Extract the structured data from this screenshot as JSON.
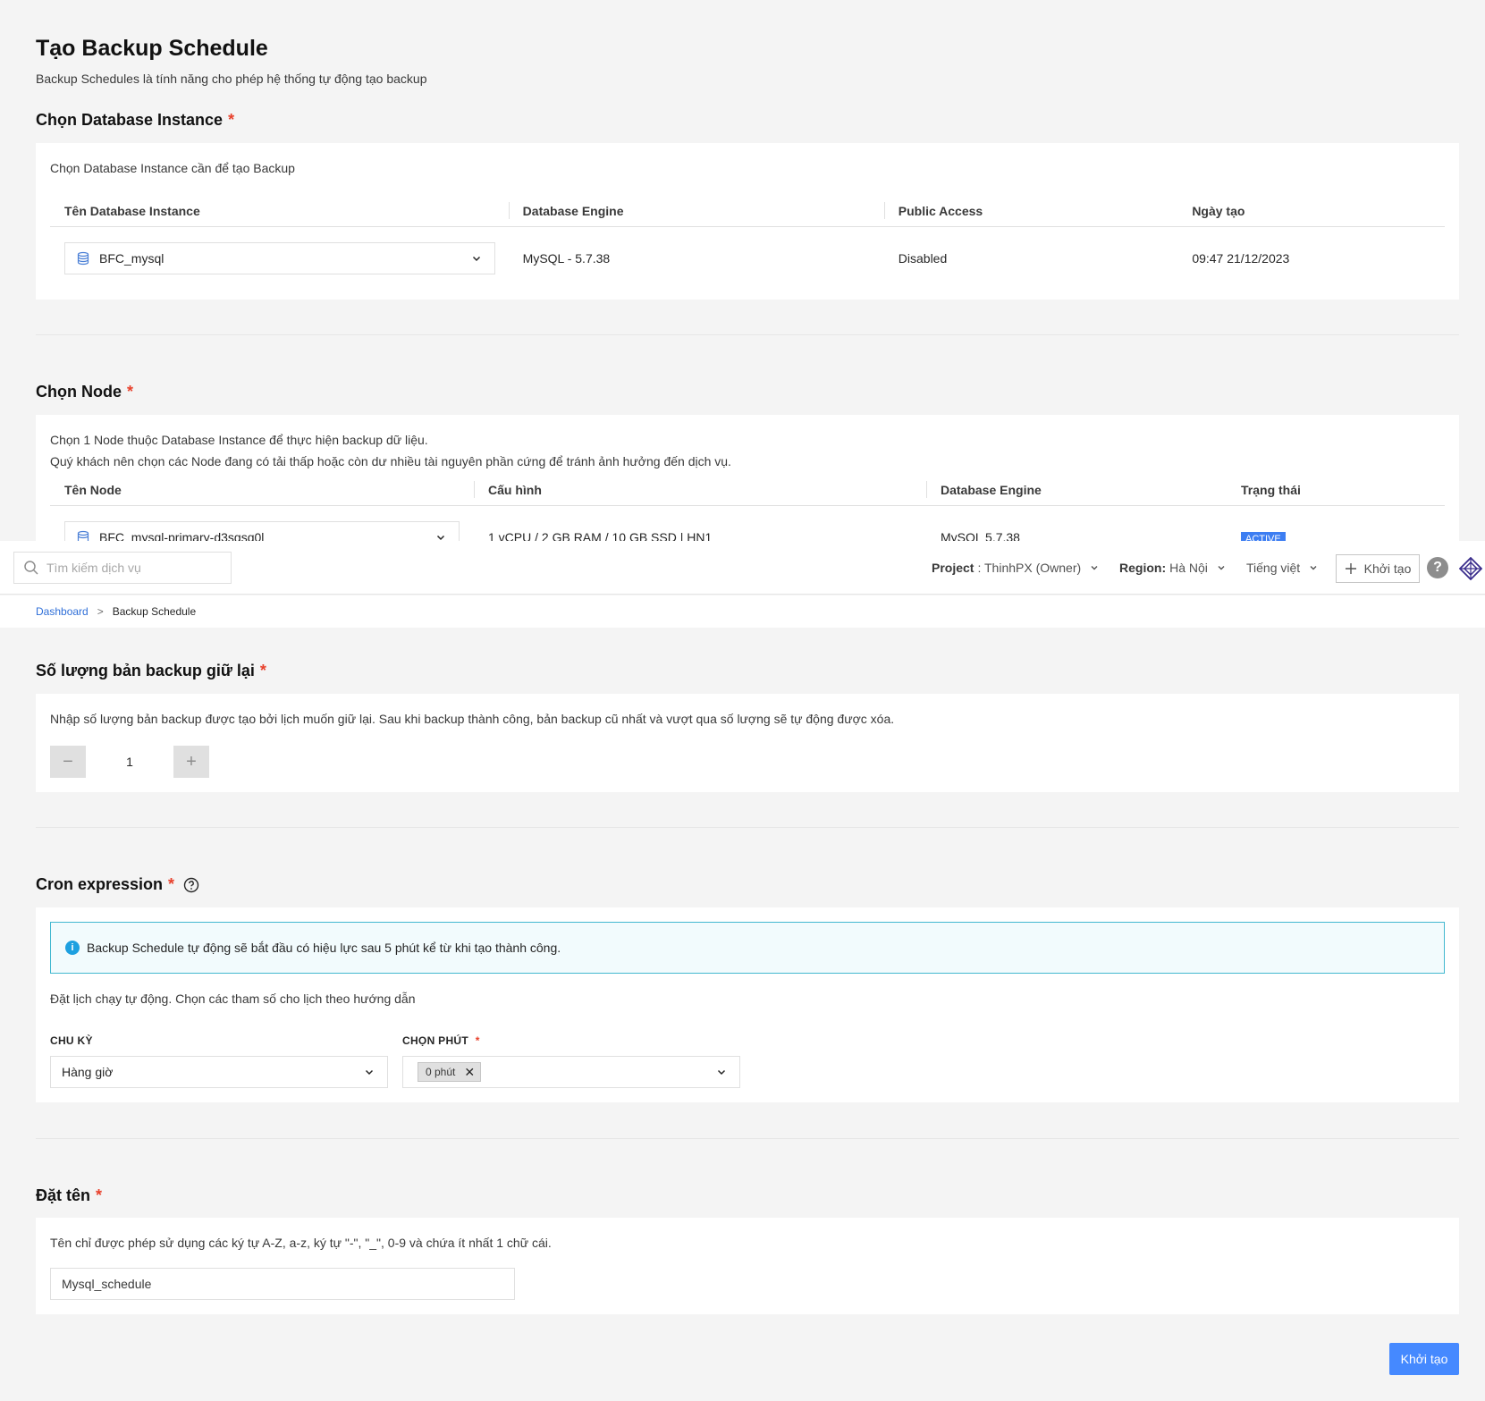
{
  "page": {
    "title": "Tạo Backup Schedule",
    "subtitle": "Backup Schedules là tính năng cho phép hệ thống tự động tạo backup"
  },
  "instance_section": {
    "title": "Chọn Database Instance",
    "required": "*",
    "description": "Chọn Database Instance cần để tạo Backup",
    "columns": [
      "Tên Database Instance",
      "Database Engine",
      "Public Access",
      "Ngày tạo"
    ],
    "row": {
      "name": "BFC_mysql",
      "engine": "MySQL - 5.7.38",
      "public_access": "Disabled",
      "created": "09:47 21/12/2023"
    }
  },
  "node_section": {
    "title": "Chọn Node",
    "required": "*",
    "description_line1": "Chọn 1 Node thuộc Database Instance để thực hiện backup dữ liệu.",
    "description_line2": "Quý khách nên chọn các Node đang có tải thấp hoặc còn dư nhiều tài nguyên phần cứng để tránh ảnh hưởng đến dịch vụ.",
    "columns": [
      "Tên Node",
      "Cấu hình",
      "Database Engine",
      "Trạng thái"
    ],
    "row": {
      "name": "BFC_mysql-primary-d3sgsq0l",
      "config": "1 vCPU / 2 GB RAM / 10 GB SSD | HN1",
      "engine": "MySQL 5.7.38",
      "status": "ACTIVE"
    }
  },
  "topbar": {
    "search_placeholder": "Tìm kiếm dịch vụ",
    "project_label": "Project",
    "project_value": ": ThinhPX (Owner)",
    "region_label": "Region:",
    "region_value": "Hà Nội",
    "language": "Tiếng việt",
    "create_label": "Khởi tạo",
    "help": "?"
  },
  "breadcrumb": {
    "home": "Dashboard",
    "separator": ">",
    "current": "Backup Schedule"
  },
  "retention_section": {
    "title": "Số lượng bản backup giữ lại",
    "required": "*",
    "description": "Nhập số lượng bản backup được tạo bởi lịch muốn giữ lại. Sau khi backup thành công, bản backup cũ nhất và vượt qua số lượng sẽ tự động được xóa.",
    "value": "1",
    "minus": "−",
    "plus": "+"
  },
  "cron_section": {
    "title": "Cron expression",
    "required": "*",
    "info_text": "Backup Schedule tự động sẽ bắt đầu có hiệu lực sau 5 phút kể từ khi tạo thành công.",
    "description": "Đặt lịch chạy tự động. Chọn các tham số cho lịch theo hướng dẫn",
    "cycle_label": "CHU KỲ",
    "cycle_value": "Hàng giờ",
    "minute_label": "CHỌN PHÚT",
    "minute_required": "*",
    "minute_tag": "0 phút"
  },
  "name_section": {
    "title": "Đặt tên",
    "required": "*",
    "description": "Tên chỉ được phép sử dụng các ký tự A-Z, a-z, ký tự \"-\", \"_\", 0-9 và chứa ít nhất 1 chữ cái.",
    "value": "Mysql_schedule"
  },
  "submit_label": "Khởi tạo",
  "colors": {
    "primary": "#4589ff",
    "required": "#e8412c",
    "link": "#2f6fd8",
    "info_border": "#42b8d0"
  }
}
